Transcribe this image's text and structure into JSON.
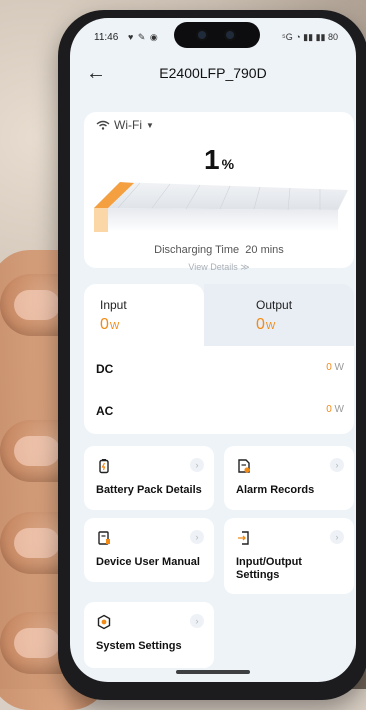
{
  "status_bar": {
    "time": "11:46",
    "left_icons": "♥ ✎ ◉",
    "right_icons": "⁵G ◔ ▮▮ ▮▮ 80"
  },
  "header": {
    "title": "E2400LFP_790D"
  },
  "battery": {
    "connection": "Wi-Fi",
    "percent": "1",
    "percent_unit": "%",
    "level": 0.01,
    "discharging_label": "Discharging Time",
    "discharging_value": "20 mins",
    "view_details": "View Details  ≫"
  },
  "power": {
    "input_label": "Input",
    "input_value": "0",
    "input_unit": "W",
    "output_label": "Output",
    "output_value": "0",
    "output_unit": "W",
    "rows": [
      {
        "label": "DC",
        "value": "0",
        "unit": "W"
      },
      {
        "label": "AC",
        "value": "0",
        "unit": "W"
      }
    ]
  },
  "tiles": [
    {
      "label": "Battery Pack Details",
      "icon": "battery-icon"
    },
    {
      "label": "Alarm Records",
      "icon": "alarm-record-icon"
    },
    {
      "label": "Device User Manual",
      "icon": "manual-icon"
    },
    {
      "label": "Input/Output Settings",
      "icon": "io-settings-icon"
    },
    {
      "label": "System Settings",
      "icon": "settings-gear-icon"
    }
  ],
  "accent": "#f28a16"
}
